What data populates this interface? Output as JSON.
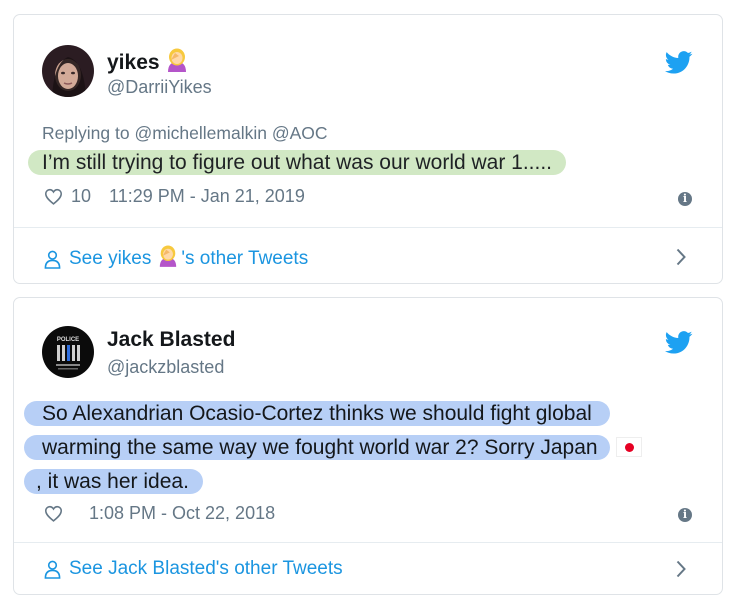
{
  "tweets": [
    {
      "name": "yikes",
      "name_emoji": "facepalm-woman-emoji",
      "handle": "@DarriiYikes",
      "reply_prefix": "Replying to",
      "reply_mentions": "@michellemalkin @AOC",
      "text_lines": [
        "I’m still trying to figure out what was our world war 1....."
      ],
      "highlight_color": "#cfe7c1",
      "likes": "10",
      "timestamp": "11:29 PM - Jan 21, 2019",
      "footer_prefix": "See yikes",
      "footer_suffix": "'s other Tweets"
    },
    {
      "name": "Jack Blasted",
      "handle": "@jackzblasted",
      "text_lines": [
        "So Alexandrian Ocasio-Cortez thinks we should fight global",
        "warming the same way we fought world war 2? Sorry Japan",
        ", it was her idea."
      ],
      "text_emoji": "japan-flag-emoji",
      "highlight_color": "#b7cff6",
      "likes": "",
      "timestamp": "1:08 PM - Oct 22, 2018",
      "footer": "See Jack Blasted's other Tweets",
      "avatar_text": "POLICE"
    }
  ],
  "colors": {
    "twitter_blue": "#1da1f2",
    "link_blue": "#1b95e0",
    "secondary_text": "#657786"
  }
}
